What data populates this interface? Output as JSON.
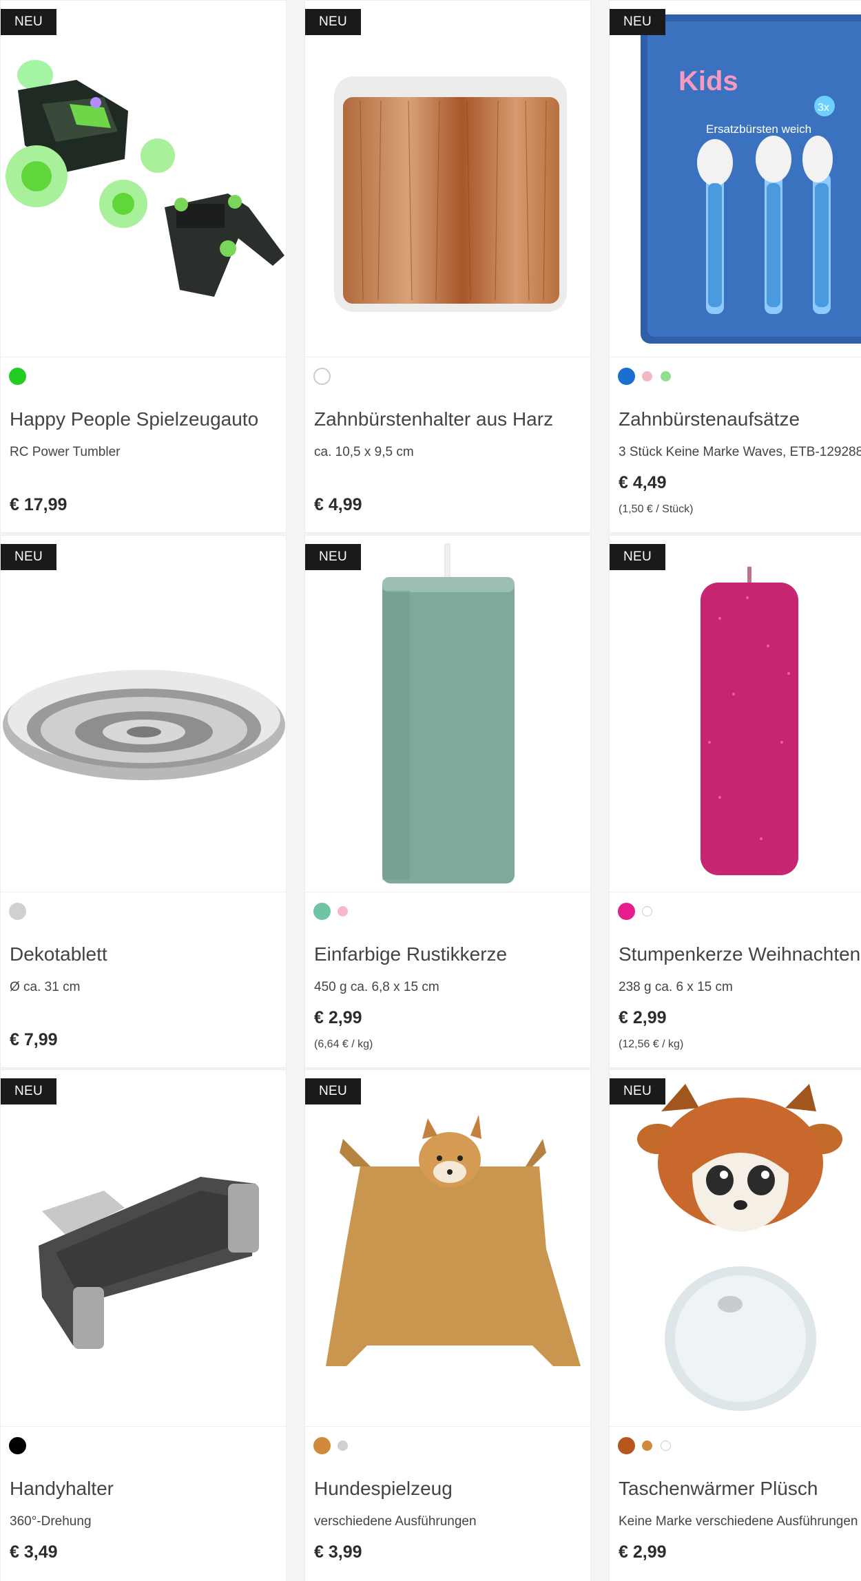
{
  "badge": "NEU",
  "products": [
    {
      "title": "Happy People Spielzeugauto",
      "subtitle": "RC Power Tumbler",
      "price": "€ 17,99",
      "unit_price": "",
      "swatches": [
        "#22cc22"
      ]
    },
    {
      "title": "Zahnbürstenhalter aus Harz",
      "subtitle": "ca. 10,5 x 9,5 cm",
      "price": "€ 4,99",
      "unit_price": "",
      "swatches": [
        "#ffffff"
      ]
    },
    {
      "title": "Zahnbürstenaufsätze",
      "subtitle": "3 Stück Keine Marke Waves, ETB-129288",
      "price": "€ 4,49",
      "unit_price": "(1,50 € / Stück)",
      "swatches": [
        "#1a6fd1",
        "#f4b8c4",
        "#90e090"
      ]
    },
    {
      "title": "Dekotablett",
      "subtitle": "Ø ca. 31 cm",
      "price": "€ 7,99",
      "unit_price": "",
      "swatches": [
        "#d0d0d0"
      ]
    },
    {
      "title": "Einfarbige Rustikkerze",
      "subtitle": "450 g ca. 6,8 x 15 cm",
      "price": "€ 2,99",
      "unit_price": "(6,64 € / kg)",
      "swatches": [
        "#6fc4a4",
        "#f4b8c8"
      ]
    },
    {
      "title": "Stumpenkerze Weihnachten",
      "subtitle": "238 g ca. 6 x 15 cm",
      "price": "€ 2,99",
      "unit_price": "(12,56 € / kg)",
      "swatches": [
        "#e81d8c",
        "#ffffff"
      ]
    },
    {
      "title": "Handyhalter",
      "subtitle": "360°-Drehung",
      "price": "€ 3,49",
      "unit_price": "",
      "swatches": [
        "#000000"
      ]
    },
    {
      "title": "Hundespielzeug",
      "subtitle": "verschiedene Ausführungen",
      "price": "€ 3,99",
      "unit_price": "",
      "swatches": [
        "#d08a3a",
        "#d0d0d0"
      ]
    },
    {
      "title": "Taschenwärmer Plüsch",
      "subtitle": "Keine Marke verschiedene Ausführungen",
      "price": "€ 2,99",
      "unit_price": "",
      "swatches": [
        "#b5561f",
        "#d08a3a",
        "#ffffff"
      ]
    }
  ],
  "image_text": {
    "kids": "Kids",
    "ersatz": "Ersatzbürsten weich",
    "count": "3x"
  }
}
